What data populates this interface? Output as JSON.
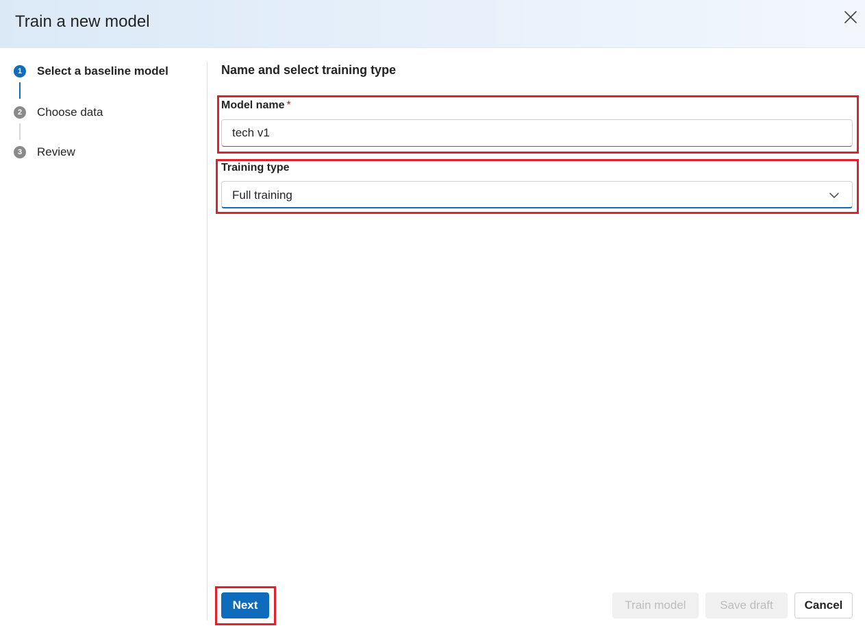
{
  "dialog": {
    "title": "Train a new model"
  },
  "steps": [
    {
      "number": "1",
      "label": "Select a baseline model",
      "state": "active"
    },
    {
      "number": "2",
      "label": "Choose data",
      "state": "inactive"
    },
    {
      "number": "3",
      "label": "Review",
      "state": "inactive"
    }
  ],
  "main": {
    "section_title": "Name and select training type",
    "model_name": {
      "label": "Model name",
      "required_marker": "*",
      "value": "tech v1"
    },
    "training_type": {
      "label": "Training type",
      "selected": "Full training"
    }
  },
  "footer": {
    "next_label": "Next",
    "train_model_label": "Train model",
    "save_draft_label": "Save draft",
    "cancel_label": "Cancel"
  },
  "colors": {
    "accent": "#0f6cbd",
    "highlight": "#e0212b",
    "required": "#c50f1f",
    "disabled_text": "#bdbdbd"
  },
  "icons": {
    "close": "close-icon",
    "dropdown": "chevron-down-icon"
  }
}
